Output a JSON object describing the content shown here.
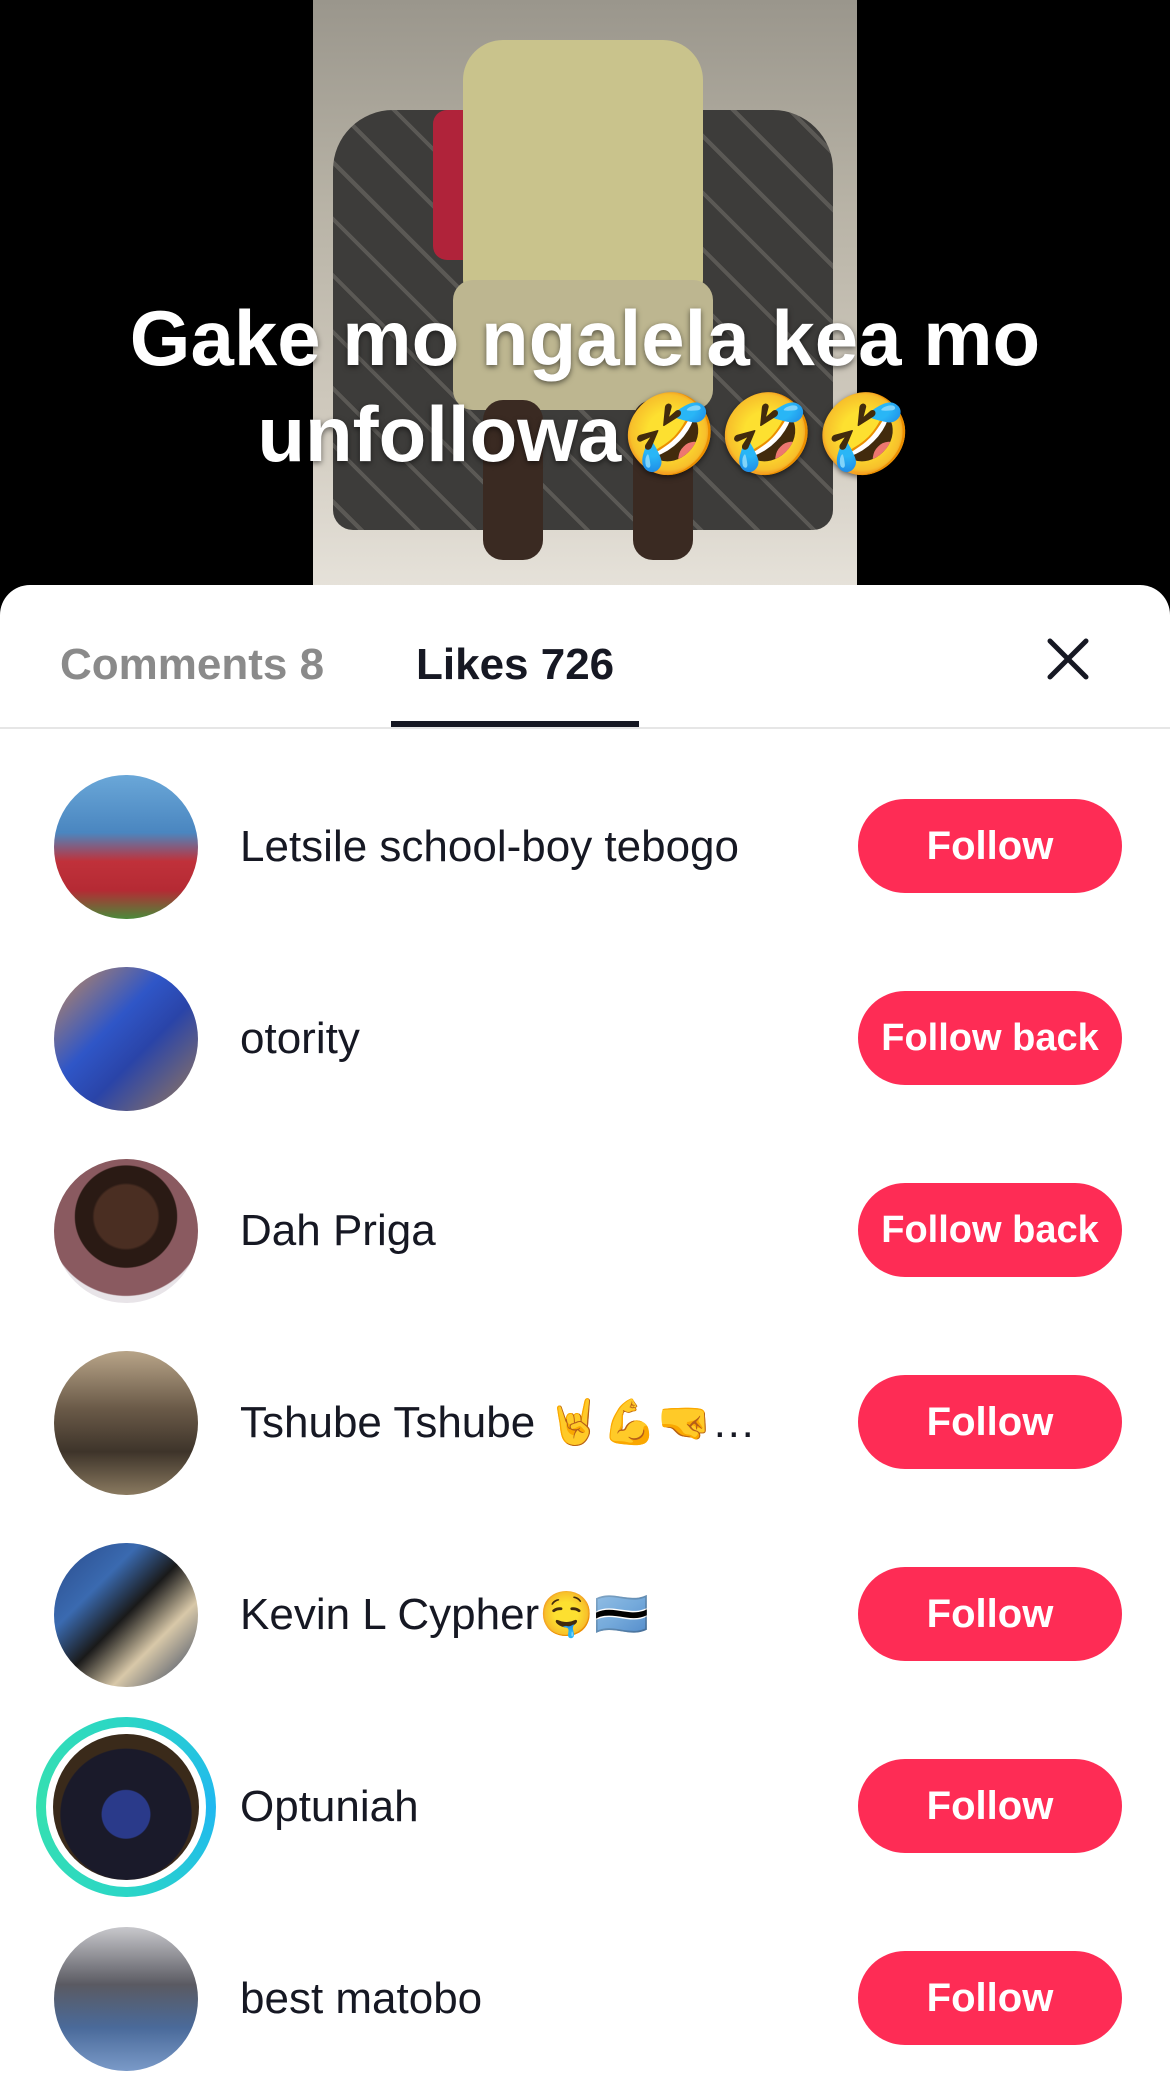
{
  "video": {
    "caption": "Gake mo ngalela kea mo unfollowa🤣🤣🤣"
  },
  "sheet": {
    "tabs": [
      {
        "label": "Comments 8"
      },
      {
        "label": "Likes 726"
      }
    ]
  },
  "likes": [
    {
      "name": "Letsile school-boy tebogo",
      "button": "Follow"
    },
    {
      "name": "otority",
      "button": "Follow back"
    },
    {
      "name": "Dah Priga",
      "button": "Follow back"
    },
    {
      "name": "Tshube Tshube 🤘💪🤜…",
      "button": "Follow"
    },
    {
      "name": "Kevin L Cypher🤤🇧🇼",
      "button": "Follow"
    },
    {
      "name": "Optuniah",
      "button": "Follow",
      "has_story_ring": true
    },
    {
      "name": "best matobo",
      "button": "Follow"
    }
  ],
  "colors": {
    "accent": "#fe2c55",
    "text": "#161823",
    "muted": "#8a8a8a",
    "story_ring": "#20b8f0"
  }
}
